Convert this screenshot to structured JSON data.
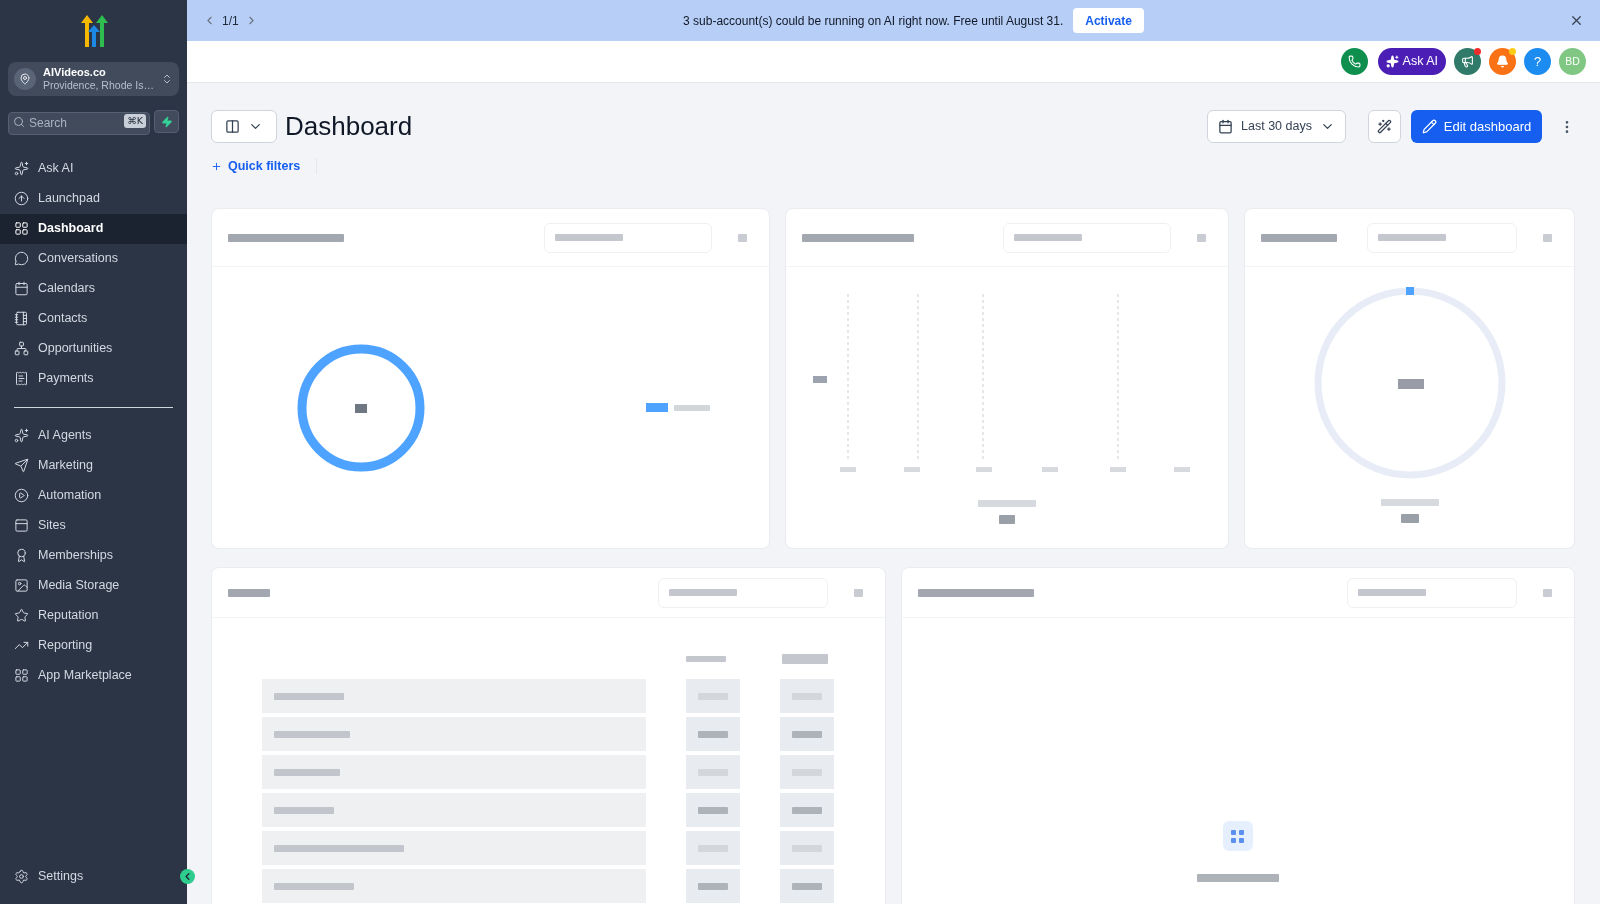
{
  "banner": {
    "pager": "1/1",
    "message": "3 sub-account(s) could be running on AI right now. Free until August 31.",
    "action": "Activate"
  },
  "sidebar": {
    "account": {
      "name": "AIVideos.co",
      "location": "Providence, Rhode Is…"
    },
    "search": {
      "placeholder": "Search",
      "shortcut": "⌘K"
    },
    "groups": [
      {
        "items": [
          {
            "label": "Ask AI",
            "selected": false
          },
          {
            "label": "Launchpad",
            "selected": false
          },
          {
            "label": "Dashboard",
            "selected": true
          },
          {
            "label": "Conversations",
            "selected": false
          },
          {
            "label": "Calendars",
            "selected": false
          },
          {
            "label": "Contacts",
            "selected": false
          },
          {
            "label": "Opportunities",
            "selected": false
          },
          {
            "label": "Payments",
            "selected": false
          }
        ]
      },
      {
        "items": [
          {
            "label": "AI Agents",
            "selected": false
          },
          {
            "label": "Marketing",
            "selected": false
          },
          {
            "label": "Automation",
            "selected": false
          },
          {
            "label": "Sites",
            "selected": false
          },
          {
            "label": "Memberships",
            "selected": false
          },
          {
            "label": "Media Storage",
            "selected": false
          },
          {
            "label": "Reputation",
            "selected": false
          },
          {
            "label": "Reporting",
            "selected": false
          },
          {
            "label": "App Marketplace",
            "selected": false
          }
        ]
      }
    ],
    "footer": {
      "label": "Settings"
    }
  },
  "header": {
    "ask_ai": "Ask AI",
    "announcements_unread": true,
    "notifications_unread": true,
    "help": "?",
    "avatar": "BD"
  },
  "toolbar": {
    "title": "Dashboard",
    "date_range": "Last 30 days",
    "edit": "Edit dashboard",
    "quick_filters": "Quick filters"
  },
  "widgets": [
    {
      "kind": "donut"
    },
    {
      "kind": "line"
    },
    {
      "kind": "gauge"
    },
    {
      "kind": "table"
    },
    {
      "kind": "empty"
    }
  ]
}
